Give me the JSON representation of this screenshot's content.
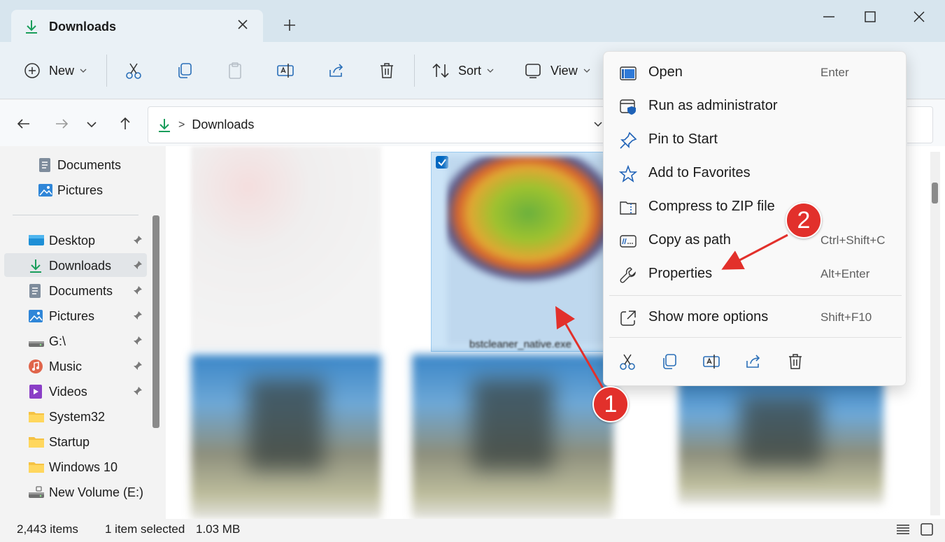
{
  "window": {
    "tab_title": "Downloads",
    "new_tab": "+"
  },
  "commandbar": {
    "new_label": "New",
    "sort_label": "Sort",
    "view_label": "View"
  },
  "address": {
    "separator": ">",
    "crumb": "Downloads"
  },
  "sidebar": {
    "quick_items": [
      {
        "label": "Documents",
        "icon": "documents-icon"
      },
      {
        "label": "Pictures",
        "icon": "pictures-icon"
      }
    ],
    "items": [
      {
        "label": "Desktop",
        "icon": "desktop-icon",
        "pinned": true
      },
      {
        "label": "Downloads",
        "icon": "download-icon",
        "pinned": true,
        "active": true
      },
      {
        "label": "Documents",
        "icon": "documents-icon",
        "pinned": true
      },
      {
        "label": "Pictures",
        "icon": "pictures-icon",
        "pinned": true
      },
      {
        "label": "G:\\",
        "icon": "drive-icon",
        "pinned": true
      },
      {
        "label": "Music",
        "icon": "music-icon",
        "pinned": true
      },
      {
        "label": "Videos",
        "icon": "videos-icon",
        "pinned": true
      },
      {
        "label": "System32",
        "icon": "folder-icon"
      },
      {
        "label": "Startup",
        "icon": "folder-icon"
      },
      {
        "label": "Windows 10",
        "icon": "folder-icon"
      },
      {
        "label": "New Volume (E:)",
        "icon": "drive-icon"
      }
    ]
  },
  "content": {
    "selected_file_name": "bstcleaner_native.exe"
  },
  "context_menu": {
    "items": [
      {
        "label": "Open",
        "shortcut": "Enter",
        "icon": "open-icon"
      },
      {
        "label": "Run as administrator",
        "shortcut": "",
        "icon": "shield-icon"
      },
      {
        "label": "Pin to Start",
        "shortcut": "",
        "icon": "pin-icon"
      },
      {
        "label": "Add to Favorites",
        "shortcut": "",
        "icon": "star-icon"
      },
      {
        "label": "Compress to ZIP file",
        "shortcut": "",
        "icon": "zip-icon"
      },
      {
        "label": "Copy as path",
        "shortcut": "Ctrl+Shift+C",
        "icon": "copy-path-icon"
      },
      {
        "label": "Properties",
        "shortcut": "Alt+Enter",
        "icon": "wrench-icon"
      }
    ],
    "more": {
      "label": "Show more options",
      "shortcut": "Shift+F10",
      "icon": "external-icon"
    }
  },
  "annotations": {
    "callout_1": "1",
    "callout_2": "2",
    "color": "#e2302b"
  },
  "statusbar": {
    "items_count": "2,443 items",
    "selection": "1 item selected",
    "size": "1.03 MB"
  },
  "colors": {
    "accent": "#0067c0",
    "selection_bg": "#cce4f7"
  }
}
